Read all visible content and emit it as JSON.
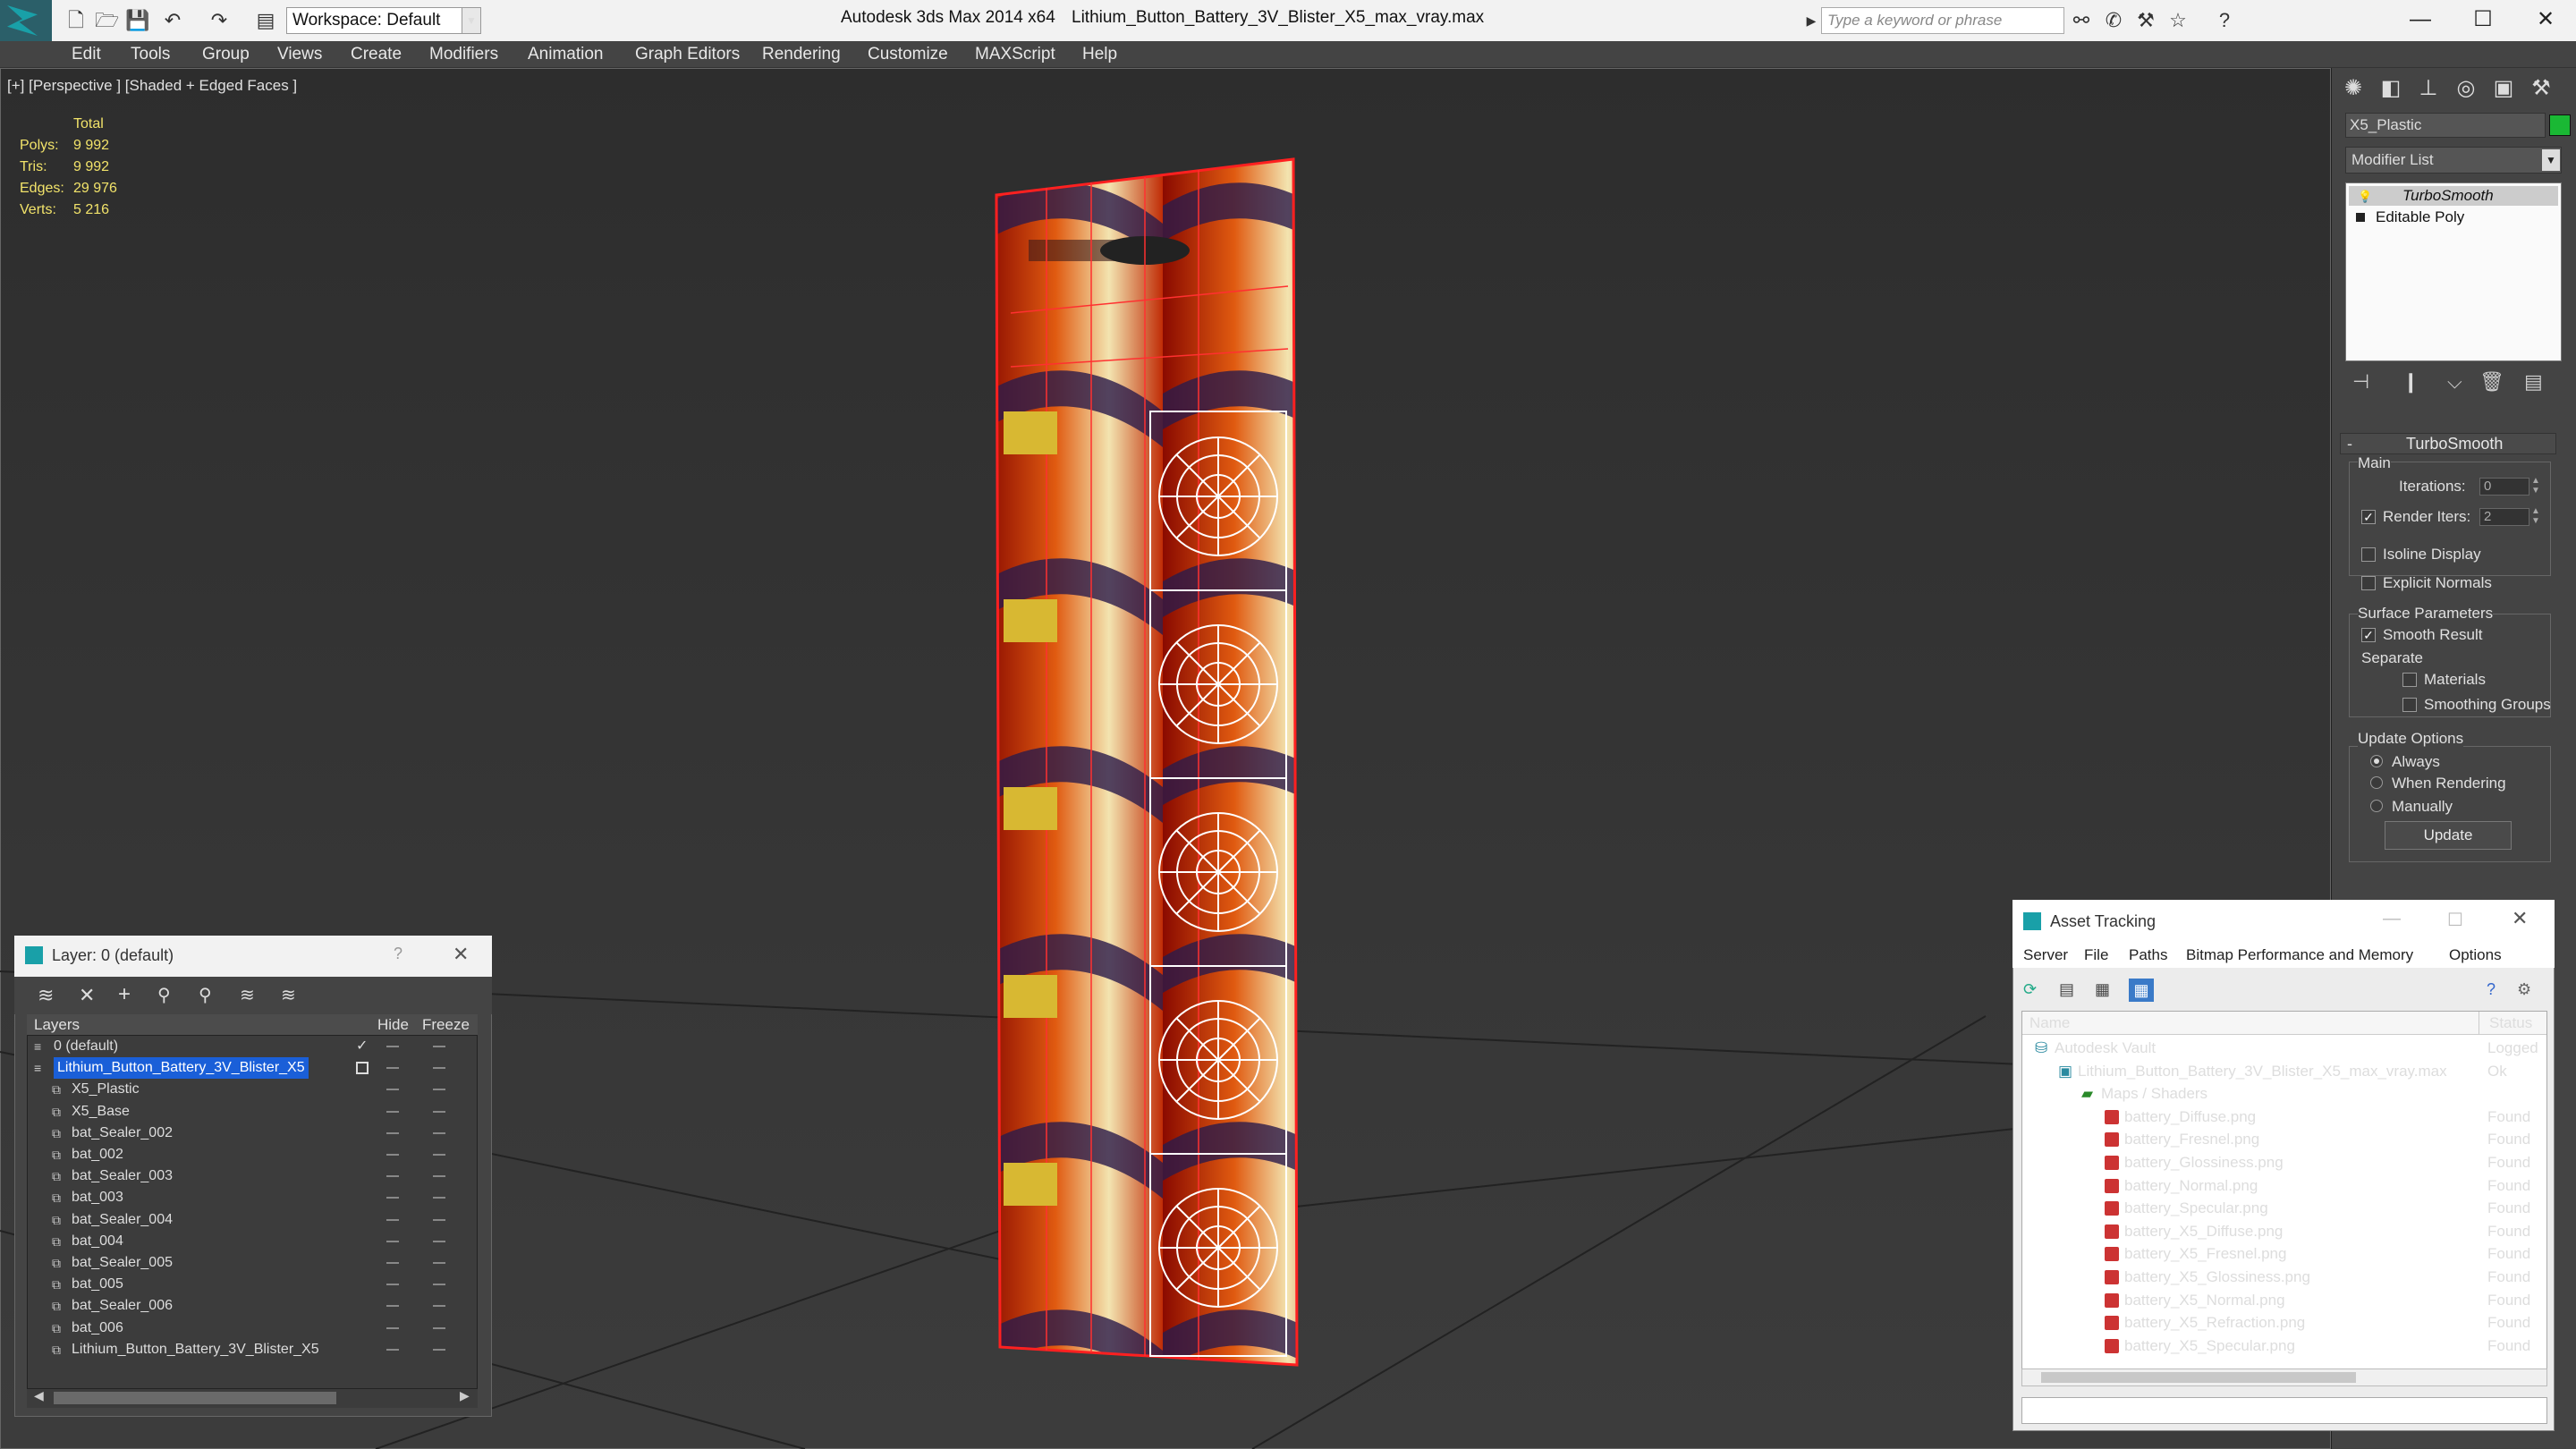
{
  "titlebar": {
    "workspace": "Workspace: Default",
    "app_title": "Autodesk 3ds Max  2014 x64",
    "file_title": "Lithium_Button_Battery_3V_Blister_X5_max_vray.max",
    "search_placeholder": "Type a keyword or phrase"
  },
  "menu": [
    "Edit",
    "Tools",
    "Group",
    "Views",
    "Create",
    "Modifiers",
    "Animation",
    "Graph Editors",
    "Rendering",
    "Customize",
    "MAXScript",
    "Help"
  ],
  "viewport": {
    "label": "[+] [Perspective ] [Shaded + Edged Faces ]",
    "stats": {
      "header": "Total",
      "rows": [
        {
          "label": "Polys:",
          "value": "9 992"
        },
        {
          "label": "Tris:",
          "value": "9 992"
        },
        {
          "label": "Edges:",
          "value": "29 976"
        },
        {
          "label": "Verts:",
          "value": "5 216"
        }
      ]
    }
  },
  "command_panel": {
    "object_name": "X5_Plastic",
    "object_color": "#1ab834",
    "modifier_list": "Modifier List",
    "stack": [
      "TurboSmooth",
      "Editable Poly"
    ],
    "turbosmooth": {
      "title": "TurboSmooth",
      "main": "Main",
      "iterations_label": "Iterations:",
      "iterations_value": "0",
      "render_iters_label": "Render Iters:",
      "render_iters_value": "2",
      "isoline": "Isoline Display",
      "explicit_normals": "Explicit Normals",
      "surface_params": "Surface Parameters",
      "smooth_result": "Smooth Result",
      "separate": "Separate",
      "materials": "Materials",
      "smoothing_groups": "Smoothing Groups",
      "update_options": "Update Options",
      "always": "Always",
      "when_rendering": "When Rendering",
      "manually": "Manually",
      "update_button": "Update"
    }
  },
  "layer_panel": {
    "title": "Layer: 0 (default)",
    "col_layers": "Layers",
    "col_hide": "Hide",
    "col_freeze": "Freeze",
    "rows": [
      {
        "name": "0 (default)",
        "level": 0,
        "type": "layer"
      },
      {
        "name": "Lithium_Button_Battery_3V_Blister_X5",
        "level": 0,
        "type": "layer",
        "selected": true
      },
      {
        "name": "X5_Plastic",
        "level": 1,
        "type": "obj"
      },
      {
        "name": "X5_Base",
        "level": 1,
        "type": "obj"
      },
      {
        "name": "bat_Sealer_002",
        "level": 1,
        "type": "obj"
      },
      {
        "name": "bat_002",
        "level": 1,
        "type": "obj"
      },
      {
        "name": "bat_Sealer_003",
        "level": 1,
        "type": "obj"
      },
      {
        "name": "bat_003",
        "level": 1,
        "type": "obj"
      },
      {
        "name": "bat_Sealer_004",
        "level": 1,
        "type": "obj"
      },
      {
        "name": "bat_004",
        "level": 1,
        "type": "obj"
      },
      {
        "name": "bat_Sealer_005",
        "level": 1,
        "type": "obj"
      },
      {
        "name": "bat_005",
        "level": 1,
        "type": "obj"
      },
      {
        "name": "bat_Sealer_006",
        "level": 1,
        "type": "obj"
      },
      {
        "name": "bat_006",
        "level": 1,
        "type": "obj"
      },
      {
        "name": "Lithium_Button_Battery_3V_Blister_X5",
        "level": 1,
        "type": "obj"
      }
    ]
  },
  "asset_tracking": {
    "title": "Asset Tracking",
    "menu": [
      "Server",
      "File",
      "Paths",
      "Bitmap Performance and Memory",
      "Options"
    ],
    "col_name": "Name",
    "col_status": "Status",
    "rows": [
      {
        "name": "Autodesk Vault",
        "status": "Logged",
        "level": 0,
        "icon": "vault"
      },
      {
        "name": "Lithium_Button_Battery_3V_Blister_X5_max_vray.max",
        "status": "Ok",
        "level": 1,
        "icon": "max"
      },
      {
        "name": "Maps / Shaders",
        "status": "",
        "level": 2,
        "icon": "folder"
      },
      {
        "name": "battery_Diffuse.png",
        "status": "Found",
        "level": 3,
        "icon": "png"
      },
      {
        "name": "battery_Fresnel.png",
        "status": "Found",
        "level": 3,
        "icon": "png"
      },
      {
        "name": "battery_Glossiness.png",
        "status": "Found",
        "level": 3,
        "icon": "png"
      },
      {
        "name": "battery_Normal.png",
        "status": "Found",
        "level": 3,
        "icon": "png"
      },
      {
        "name": "battery_Specular.png",
        "status": "Found",
        "level": 3,
        "icon": "png"
      },
      {
        "name": "battery_X5_Diffuse.png",
        "status": "Found",
        "level": 3,
        "icon": "png"
      },
      {
        "name": "battery_X5_Fresnel.png",
        "status": "Found",
        "level": 3,
        "icon": "png"
      },
      {
        "name": "battery_X5_Glossiness.png",
        "status": "Found",
        "level": 3,
        "icon": "png"
      },
      {
        "name": "battery_X5_Normal.png",
        "status": "Found",
        "level": 3,
        "icon": "png"
      },
      {
        "name": "battery_X5_Refraction.png",
        "status": "Found",
        "level": 3,
        "icon": "png"
      },
      {
        "name": "battery_X5_Specular.png",
        "status": "Found",
        "level": 3,
        "icon": "png"
      }
    ]
  }
}
